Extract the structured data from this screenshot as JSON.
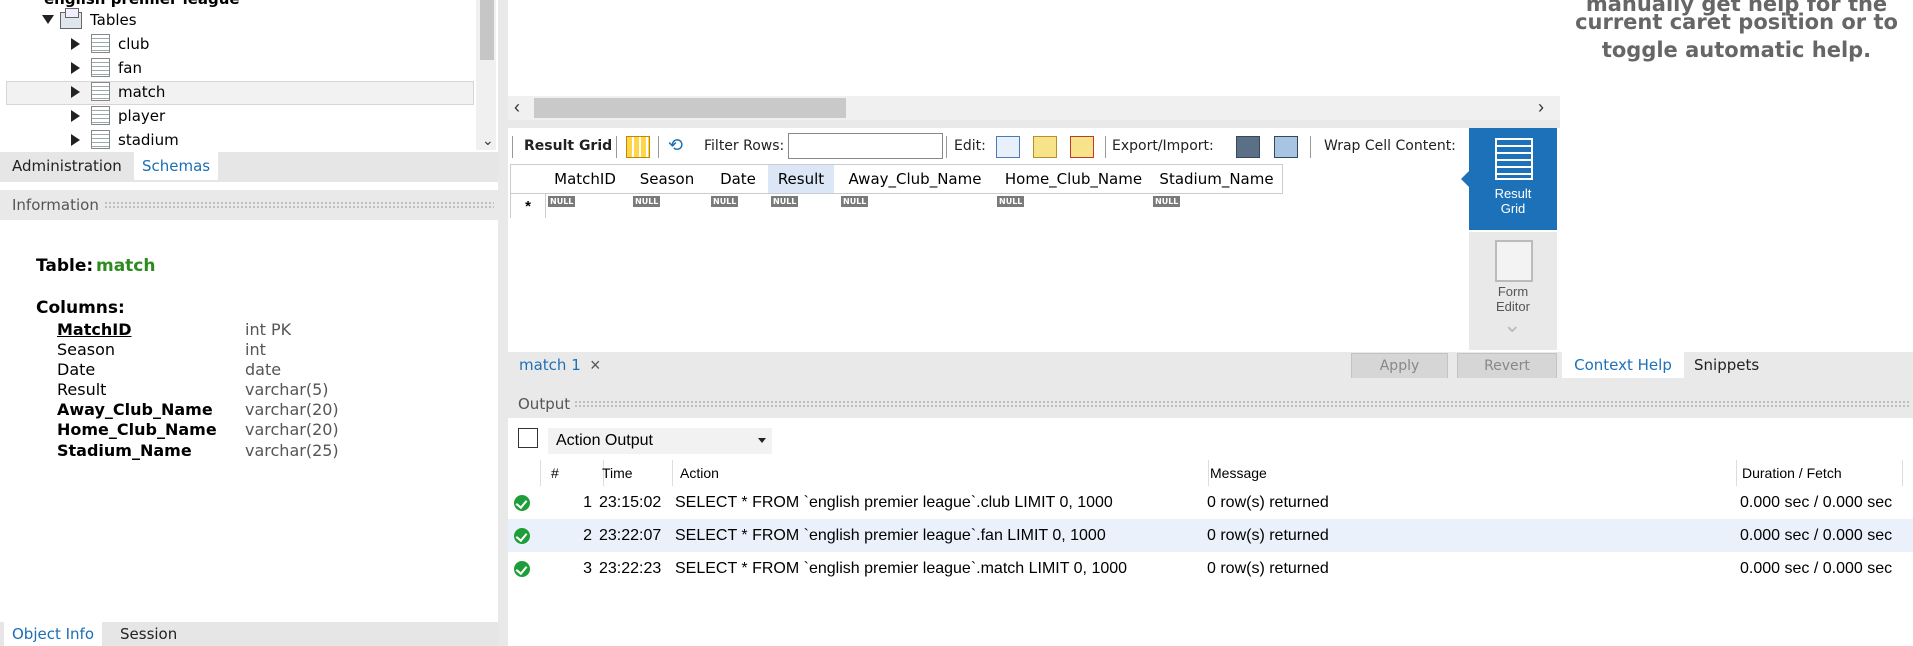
{
  "schema_tree": {
    "schema_name": "english premier league",
    "tables_label": "Tables",
    "tables": [
      "club",
      "fan",
      "match",
      "player",
      "stadium"
    ],
    "selected_table": "match"
  },
  "left_tabs": {
    "administration": "Administration",
    "schemas": "Schemas"
  },
  "information": {
    "header": "Information",
    "table_prefix": "Table:",
    "table_name": "match",
    "columns_label": "Columns:",
    "columns": [
      {
        "name": "MatchID",
        "type": "int PK"
      },
      {
        "name": "Season",
        "type": "int"
      },
      {
        "name": "Date",
        "type": "date"
      },
      {
        "name": "Result",
        "type": "varchar(5)"
      },
      {
        "name": "Away_Club_Name",
        "type": "varchar(20)"
      },
      {
        "name": "Home_Club_Name",
        "type": "varchar(20)"
      },
      {
        "name": "Stadium_Name",
        "type": "varchar(25)"
      }
    ]
  },
  "bottom_left_tabs": {
    "object_info": "Object Info",
    "session": "Session"
  },
  "result_toolbar": {
    "result_grid": "Result Grid",
    "filter_rows": "Filter Rows:",
    "filter_value": "",
    "edit": "Edit:",
    "export_import": "Export/Import:",
    "wrap_cell": "Wrap Cell Content:"
  },
  "grid": {
    "columns": [
      "MatchID",
      "Season",
      "Date",
      "Result",
      "Away_Club_Name",
      "Home_Club_Name",
      "Stadium_Name"
    ],
    "selected_column": "Result",
    "null_label": "NULL",
    "new_row_marker": "*"
  },
  "side_buttons": {
    "result_grid": [
      "Result",
      "Grid"
    ],
    "form_editor": [
      "Form",
      "Editor"
    ]
  },
  "result_tab": {
    "label": "match 1",
    "close": "×"
  },
  "actions": {
    "apply": "Apply",
    "revert": "Revert"
  },
  "help_tabs": {
    "context_help": "Context Help",
    "snippets": "Snippets"
  },
  "help_text": [
    "manually get help for the",
    "current caret position or to",
    "toggle automatic help."
  ],
  "output": {
    "header": "Output",
    "selector": "Action Output",
    "columns": [
      "#",
      "Time",
      "Action",
      "Message",
      "Duration / Fetch"
    ],
    "rows": [
      {
        "n": "1",
        "time": "23:15:02",
        "action": "SELECT * FROM `english premier league`.club LIMIT 0, 1000",
        "message": "0 row(s) returned",
        "duration": "0.000 sec / 0.000 sec"
      },
      {
        "n": "2",
        "time": "23:22:07",
        "action": "SELECT * FROM `english premier league`.fan LIMIT 0, 1000",
        "message": "0 row(s) returned",
        "duration": "0.000 sec / 0.000 sec"
      },
      {
        "n": "3",
        "time": "23:22:23",
        "action": "SELECT * FROM `english premier league`.match LIMIT 0, 1000",
        "message": "0 row(s) returned",
        "duration": "0.000 sec / 0.000 sec"
      }
    ]
  },
  "colors": {
    "accent": "#1d71b8",
    "ok": "#1e9e3a",
    "column_name_green": "#2e8b1f"
  }
}
